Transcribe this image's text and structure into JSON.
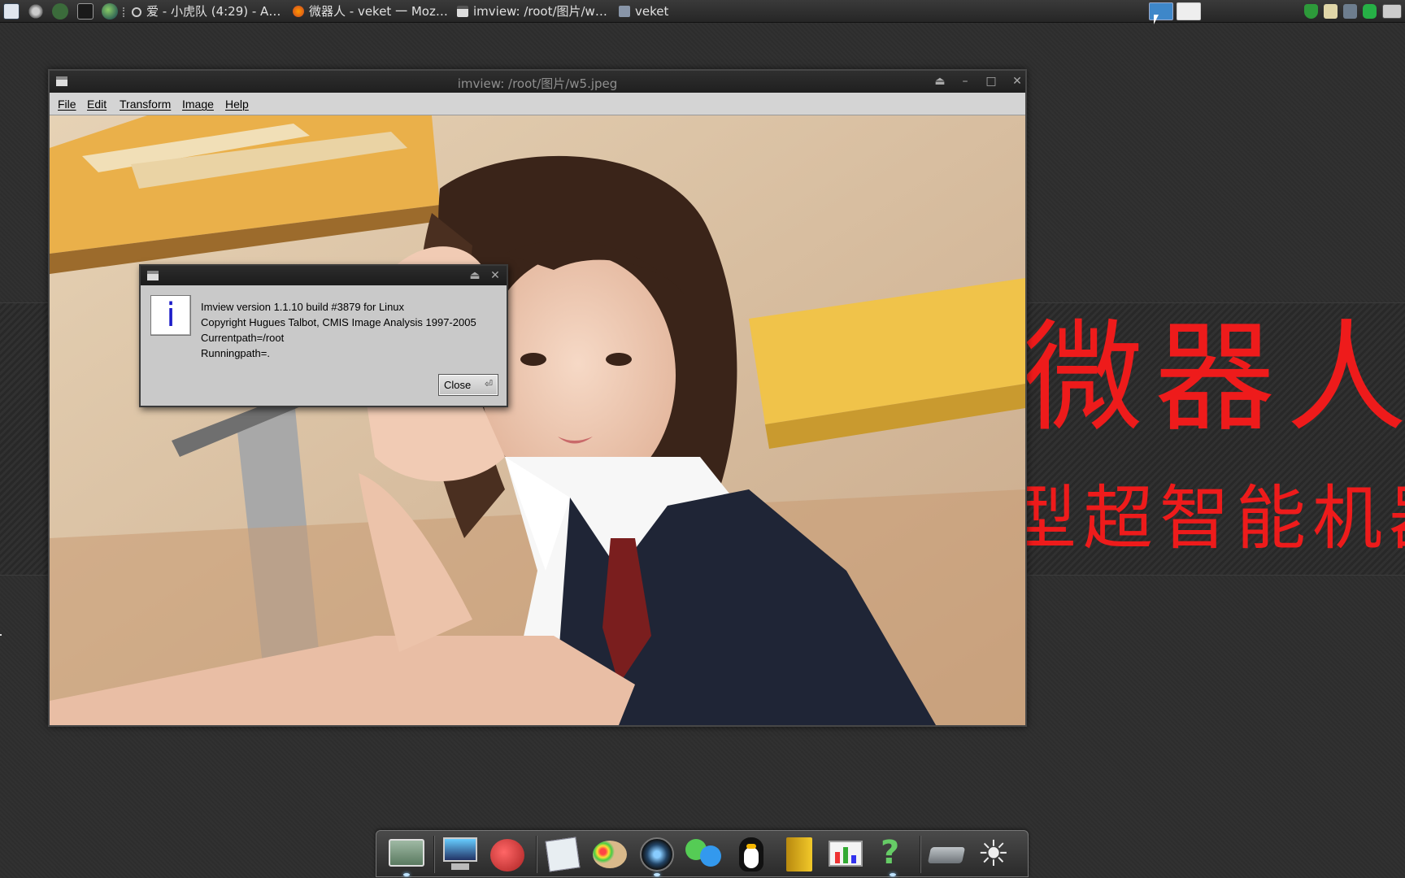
{
  "top_panel": {
    "tasks": [
      {
        "icon": "dot-icon",
        "label": "爱 - 小虎队 (4:29) - A…"
      },
      {
        "icon": "firefox-icon",
        "label": "微器人 - veket 一 Moz…"
      },
      {
        "icon": "window-icon",
        "label": "imview: /root/图片/w…"
      },
      {
        "icon": "folder-icon",
        "label": "veket"
      }
    ]
  },
  "desktop": {
    "banner_title": "微器人",
    "banner_subtitle": "型超智能机器"
  },
  "imview": {
    "title": "imview: /root/图片/w5.jpeg",
    "menu": [
      "File",
      "Edit",
      "Transform",
      "Image",
      "Help"
    ]
  },
  "about": {
    "icon_letter": "i",
    "lines": [
      "Imview version 1.1.10 build #3879 for Linux",
      "Copyright Hugues Talbot, CMIS Image Analysis 1997-2005",
      "Currentpath=/root",
      "Runningpath=."
    ],
    "close_label": "Close",
    "close_key_glyph": "⏎"
  },
  "colors": {
    "banner_red": "#ee1b1b",
    "menubar_bg": "#d4d4d4",
    "dialog_bg": "#c9c9c9",
    "info_blue": "#1c1cc8"
  }
}
